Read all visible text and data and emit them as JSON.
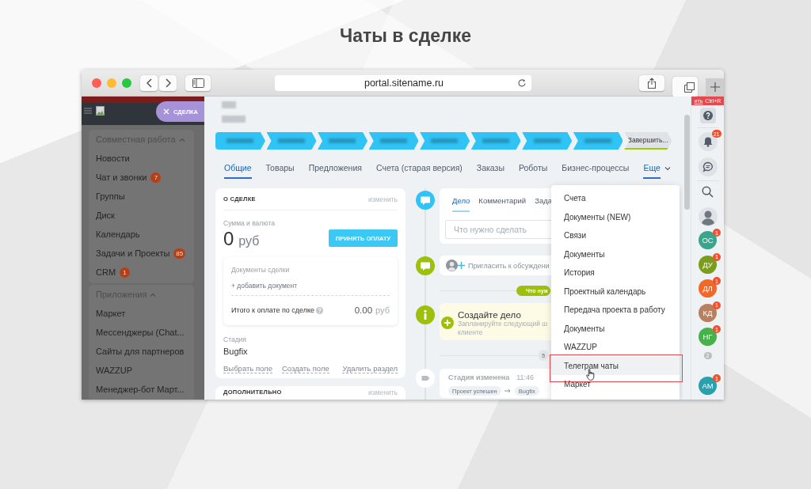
{
  "page_title": "Чаты в сделке",
  "browser": {
    "url": "portal.sitename.ru"
  },
  "sidebar": {
    "mode_button": "СДЕЛКА",
    "groups": [
      {
        "title": "Совместная работа",
        "expanded": true,
        "items": [
          {
            "label": "Новости"
          },
          {
            "label": "Чат и звонки",
            "badge": "7"
          },
          {
            "label": "Группы"
          },
          {
            "label": "Диск"
          },
          {
            "label": "Календарь"
          },
          {
            "label": "Задачи и Проекты",
            "badge": "85"
          },
          {
            "label": "CRM",
            "badge": "1"
          }
        ]
      },
      {
        "title": "Приложения",
        "expanded": true,
        "items": [
          {
            "label": "Маркет"
          },
          {
            "label": "Мессенджеры (Chat..."
          },
          {
            "label": "Сайты для партнеров"
          },
          {
            "label": "WAZZUP"
          },
          {
            "label": "Менеджер-бот Март..."
          }
        ]
      }
    ]
  },
  "deal": {
    "stages": [
      {
        "reached": true
      },
      {
        "reached": true
      },
      {
        "reached": true
      },
      {
        "reached": true
      },
      {
        "reached": true
      },
      {
        "reached": true
      },
      {
        "reached": true
      },
      {
        "reached": true
      }
    ],
    "finish_stage": {
      "label": "Завершить...",
      "reached": false
    },
    "tabs": [
      {
        "label": "Общие",
        "selected": true
      },
      {
        "label": "Товары",
        "selected": false
      },
      {
        "label": "Предложения",
        "selected": false
      },
      {
        "label": "Счета (старая версия)",
        "selected": false
      },
      {
        "label": "Заказы",
        "selected": false
      },
      {
        "label": "Роботы",
        "selected": false
      },
      {
        "label": "Бизнес-процессы",
        "selected": false
      }
    ],
    "more_tab": {
      "label": "Еще",
      "expanded": true
    }
  },
  "about_card": {
    "title": "О СДЕЛКЕ",
    "edit_link": "изменить",
    "amount_label": "Сумма и валюта",
    "amount": "0",
    "currency": "руб",
    "pay_button": "ПРИНЯТЬ ОПЛАТУ",
    "documents": {
      "title": "Документы сделки",
      "add_link": "+ добавить документ",
      "total_label": "Итого к оплате по сделке",
      "total_amount": "0.00",
      "total_currency": "руб"
    },
    "stage_label": "Стадия",
    "stage_value": "Bugfix",
    "field_links": [
      "Выбрать поле",
      "Создать поле"
    ],
    "delete_link": "Удалить раздел"
  },
  "extra_card": {
    "title": "ДОПОЛНИТЕЛЬНО",
    "edit_link": "изменить"
  },
  "timeline": {
    "editor": {
      "tabs": [
        {
          "label": "Дело",
          "selected": true
        },
        {
          "label": "Комментарий",
          "selected": false
        },
        {
          "label": "Зада",
          "selected": false
        }
      ],
      "placeholder": "Что нужно сделать"
    },
    "invite_text": "Пригласить к обсуждени",
    "todo_pill": "Что нуж",
    "create_task": {
      "title": "Создайте дело",
      "lines": [
        "Запланируйте следующий ш",
        "клиенте"
      ]
    },
    "date_pill": "5",
    "stage_event": {
      "title": "Стадия изменена",
      "time": "11:46",
      "from": "Проект успешен",
      "to": "Bugfix"
    }
  },
  "more_menu": {
    "items": [
      {
        "label": "Счета",
        "highlighted": false
      },
      {
        "label": "Документы (NEW)",
        "highlighted": false
      },
      {
        "label": "Связи",
        "highlighted": false
      },
      {
        "label": "Документы",
        "highlighted": false
      },
      {
        "label": "История",
        "highlighted": false
      },
      {
        "label": "Проектный календарь",
        "highlighted": false
      },
      {
        "label": "Передача проекта в работу",
        "highlighted": false
      },
      {
        "label": "Документы",
        "highlighted": false
      },
      {
        "label": "WAZZUP",
        "highlighted": false
      },
      {
        "label": "Телеграм чаты",
        "highlighted": true
      },
      {
        "label": "Маркет",
        "highlighted": false
      }
    ]
  },
  "right_bar": {
    "hotkey_hint": {
      "link": "ить",
      "keys": "Ctrl+R"
    },
    "notifications_badge": "21",
    "contacts": [
      {
        "kind": "avatar",
        "initials": "ОС",
        "color": "#3aa48d",
        "badge": "1"
      },
      {
        "kind": "avatar",
        "initials": "ДУ",
        "color": "#7b9c1c",
        "badge": "1"
      },
      {
        "kind": "avatar",
        "initials": "ДЛ",
        "color": "#f0682a",
        "badge": "1"
      },
      {
        "kind": "avatar",
        "initials": "КД",
        "color": "#b98060",
        "badge": "1"
      },
      {
        "kind": "avatar",
        "initials": "НГ",
        "color": "#47b24b",
        "badge": "1"
      },
      {
        "kind": "counter",
        "count": "2"
      },
      {
        "kind": "avatar",
        "initials": "АМ",
        "color": "#2a9fae",
        "badge": "1"
      }
    ]
  }
}
